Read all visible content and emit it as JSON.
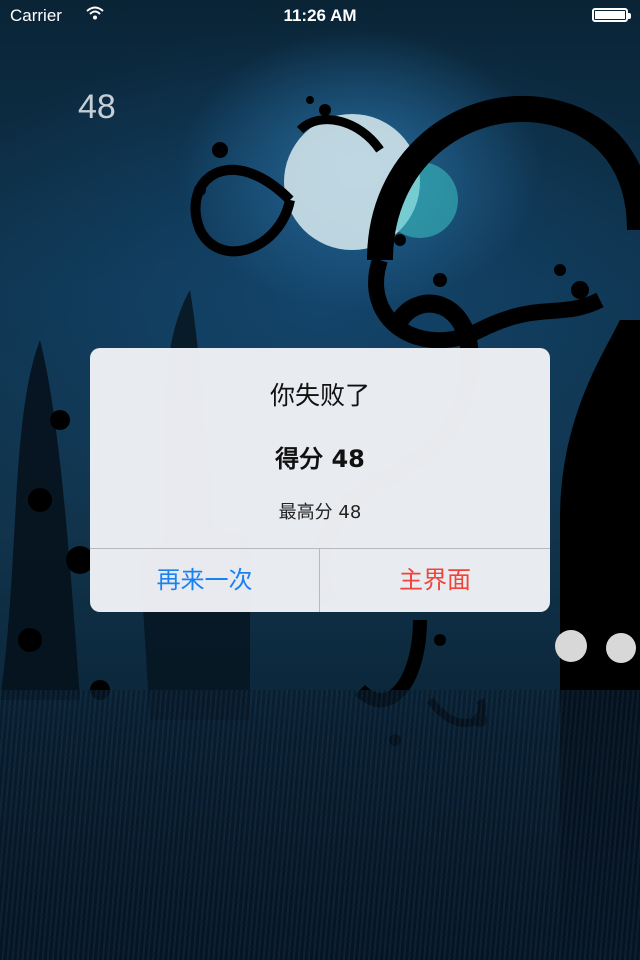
{
  "status_bar": {
    "carrier": "Carrier",
    "time": "11:26 AM"
  },
  "game": {
    "score": "48"
  },
  "dialog": {
    "title": "你失败了",
    "score_text": "得分 48",
    "best_text": "最高分 48",
    "retry_label": "再来一次",
    "home_label": "主界面"
  },
  "colors": {
    "retry": "#1a82f0",
    "home": "#f0443a"
  }
}
